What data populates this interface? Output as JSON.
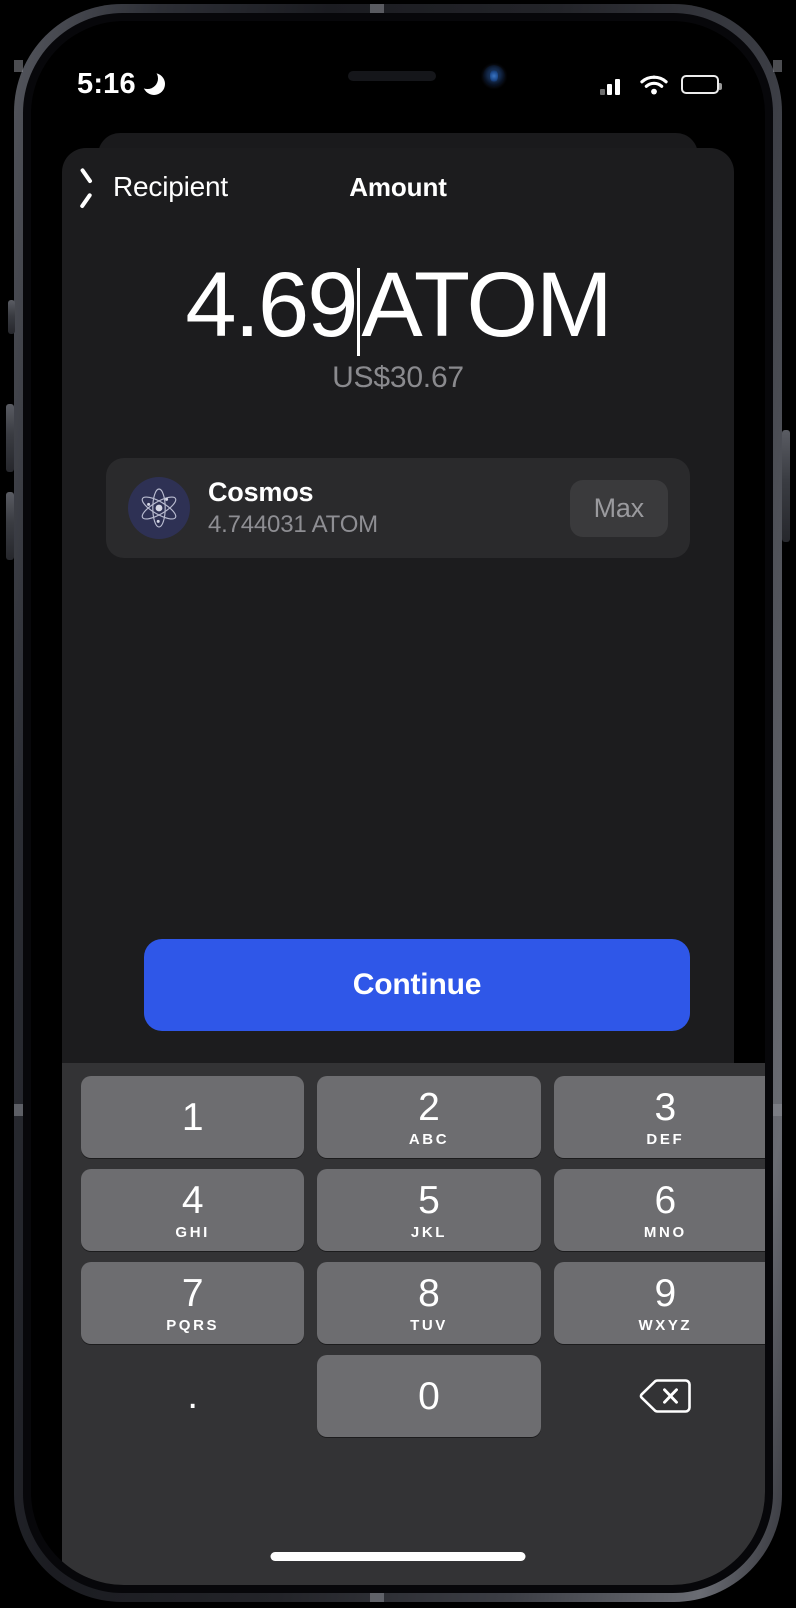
{
  "status_bar": {
    "time": "5:16",
    "dnd_icon": "moon-icon",
    "cellular_icon": "cellular-signal-icon",
    "wifi_icon": "wifi-icon",
    "battery_icon": "battery-icon"
  },
  "nav": {
    "back_label": "Recipient",
    "back_icon": "chevron-left-icon",
    "title": "Amount"
  },
  "amount": {
    "value": "4.69",
    "ticker": "ATOM",
    "fiat": "US$30.67"
  },
  "asset": {
    "logo_icon": "cosmos-atom-icon",
    "name": "Cosmos",
    "balance": "4.744031 ATOM",
    "max_label": "Max"
  },
  "actions": {
    "continue_label": "Continue"
  },
  "keypad": {
    "keys": [
      {
        "digit": "1",
        "letters": ""
      },
      {
        "digit": "2",
        "letters": "ABC"
      },
      {
        "digit": "3",
        "letters": "DEF"
      },
      {
        "digit": "4",
        "letters": "GHI"
      },
      {
        "digit": "5",
        "letters": "JKL"
      },
      {
        "digit": "6",
        "letters": "MNO"
      },
      {
        "digit": "7",
        "letters": "PQRS"
      },
      {
        "digit": "8",
        "letters": "TUV"
      },
      {
        "digit": "9",
        "letters": "WXYZ"
      },
      {
        "digit": ".",
        "letters": ""
      },
      {
        "digit": "0",
        "letters": ""
      },
      {
        "digit": "",
        "letters": "",
        "icon": "backspace-icon"
      }
    ]
  },
  "colors": {
    "accent": "#2f57e8",
    "sheet_bg": "#1c1c1e",
    "card_bg": "#2a2a2c",
    "keypad_bg": "#333335",
    "key_bg": "#6d6d70",
    "secondary_text": "#8e8e93",
    "cosmos_badge": "#2e3154"
  }
}
